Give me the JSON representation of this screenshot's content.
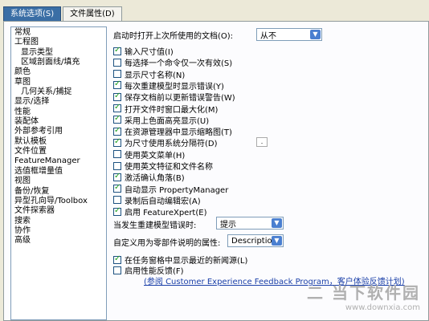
{
  "tabs": [
    {
      "label": "系统选项(S)"
    },
    {
      "label": "文件属性(D)"
    }
  ],
  "tree": [
    {
      "label": "常规"
    },
    {
      "label": "工程图"
    },
    {
      "label": "显示类型"
    },
    {
      "label": "区域剖面线/填充"
    },
    {
      "label": "颜色"
    },
    {
      "label": "草图"
    },
    {
      "label": "几何关系/捕捉"
    },
    {
      "label": "显示/选择"
    },
    {
      "label": "性能"
    },
    {
      "label": "装配体"
    },
    {
      "label": "外部参考引用"
    },
    {
      "label": "默认模板"
    },
    {
      "label": "文件位置"
    },
    {
      "label": "FeatureManager"
    },
    {
      "label": "选值框增量值"
    },
    {
      "label": "视图"
    },
    {
      "label": "备份/恢复"
    },
    {
      "label": "异型孔向导/Toolbox"
    },
    {
      "label": "文件探索器"
    },
    {
      "label": "搜索"
    },
    {
      "label": "协作"
    },
    {
      "label": "高级"
    }
  ],
  "startup": {
    "label": "启动时打开上次所使用的文档(O):",
    "value": "从不"
  },
  "options": [
    {
      "label": "输入尺寸值(I)",
      "checked": true
    },
    {
      "label": "每选择一个命令仅一次有效(S)",
      "checked": false
    },
    {
      "label": "显示尺寸名称(N)",
      "checked": false
    },
    {
      "label": "每次重建模型时显示错误(Y)",
      "checked": true
    },
    {
      "label": "保存文档前以更新错误警告(W)",
      "checked": true
    },
    {
      "label": "打开文件时窗口最大化(M)",
      "checked": true
    },
    {
      "label": "采用上色面高亮显示(U)",
      "checked": true
    },
    {
      "label": "在资源管理器中显示缩略图(T)",
      "checked": true
    },
    {
      "label": "为尺寸使用系统分隔符(D)",
      "checked": true,
      "extra": "."
    },
    {
      "label": "使用英文菜单(H)",
      "checked": false
    },
    {
      "label": "使用英文特征和文件名称",
      "checked": false
    },
    {
      "label": "激活确认角落(B)",
      "checked": true
    },
    {
      "label": "自动显示 PropertyManager",
      "checked": true
    },
    {
      "label": "录制后自动编辑宏(A)",
      "checked": false
    },
    {
      "label": "启用 FeatureXpert(E)",
      "checked": true
    }
  ],
  "rebuild_error": {
    "label": "当发生重建模型错误时:",
    "value": "提示"
  },
  "custom_prop": {
    "label": "自定义用为零部件说明的属性:",
    "value": "Description"
  },
  "options2": [
    {
      "label": "在任务窗格中显示最近的新闻源(L)",
      "checked": true
    },
    {
      "label": "启用性能反馈(F)",
      "checked": false
    }
  ],
  "feedback_link": "(参阅 Customer Experience Feedback Program，客户体验反馈计划)",
  "watermark": {
    "line1": "二 当下软件园",
    "line2": "www.downxia.com"
  }
}
